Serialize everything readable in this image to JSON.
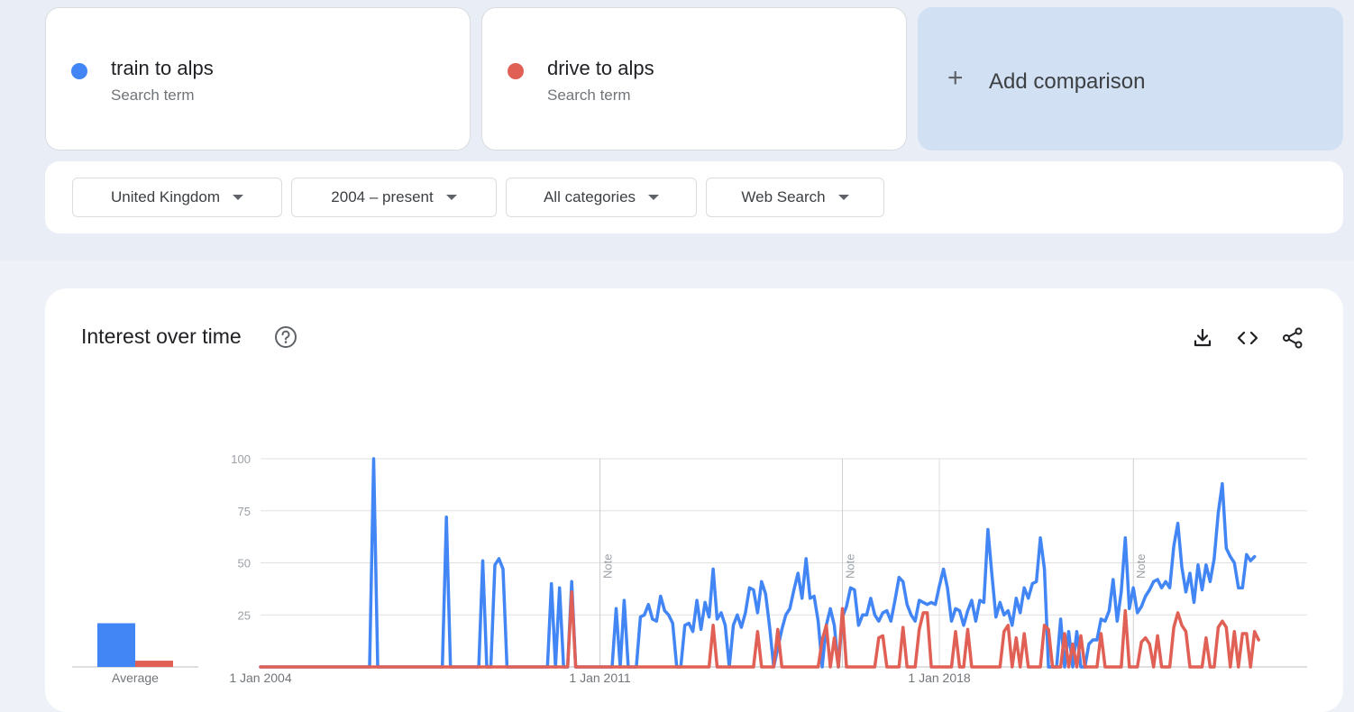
{
  "terms": [
    {
      "name": "train to alps",
      "type": "Search term",
      "color": "#4285f4"
    },
    {
      "name": "drive to alps",
      "type": "Search term",
      "color": "#e06055"
    }
  ],
  "add_comparison": {
    "icon": "+",
    "label": "Add comparison"
  },
  "filters": [
    {
      "label": "United Kingdom"
    },
    {
      "label": "2004 – present"
    },
    {
      "label": "All categories"
    },
    {
      "label": "Web Search"
    }
  ],
  "panel": {
    "title": "Interest over time",
    "icons": [
      "help-circle-icon",
      "download-icon",
      "embed-code-icon",
      "share-icon"
    ]
  },
  "average": {
    "label": "Average",
    "values": [
      21,
      3
    ]
  },
  "note_label": "Note",
  "chart_data": {
    "type": "line",
    "title": "",
    "xlabel": "",
    "ylabel": "",
    "ylim": [
      0,
      100
    ],
    "yticks": [
      25,
      50,
      75,
      100
    ],
    "xticks": [
      {
        "label": "1 Jan 2004",
        "date": "2004-01"
      },
      {
        "label": "1 Jan 2011",
        "date": "2011-01"
      },
      {
        "label": "1 Jan 2018",
        "date": "2018-01"
      }
    ],
    "x_range": [
      "2004-01",
      "2025-08"
    ],
    "notes": [
      "2011-01",
      "2016-01",
      "2022-01"
    ],
    "grid": true,
    "series": [
      {
        "name": "train to alps",
        "color": "#4285f4",
        "points": [
          [
            "2004-01",
            0
          ],
          [
            "2006-04",
            0
          ],
          [
            "2006-05",
            100
          ],
          [
            "2006-06",
            0
          ],
          [
            "2007-10",
            0
          ],
          [
            "2007-11",
            72
          ],
          [
            "2007-12",
            0
          ],
          [
            "2008-07",
            0
          ],
          [
            "2008-08",
            51
          ],
          [
            "2008-09",
            0
          ],
          [
            "2008-10",
            0
          ],
          [
            "2008-11",
            49
          ],
          [
            "2008-12",
            52
          ],
          [
            "2009-01",
            47
          ],
          [
            "2009-02",
            0
          ],
          [
            "2009-12",
            0
          ],
          [
            "2010-01",
            40
          ],
          [
            "2010-02",
            0
          ],
          [
            "2010-03",
            38
          ],
          [
            "2010-04",
            0
          ],
          [
            "2010-05",
            0
          ],
          [
            "2010-06",
            41
          ],
          [
            "2010-07",
            0
          ],
          [
            "2011-04",
            0
          ],
          [
            "2011-05",
            28
          ],
          [
            "2011-06",
            0
          ],
          [
            "2011-07",
            32
          ],
          [
            "2011-08",
            0
          ],
          [
            "2011-10",
            0
          ],
          [
            "2011-11",
            24
          ],
          [
            "2011-12",
            25
          ],
          [
            "2012-01",
            30
          ],
          [
            "2012-02",
            23
          ],
          [
            "2012-03",
            22
          ],
          [
            "2012-04",
            34
          ],
          [
            "2012-05",
            27
          ],
          [
            "2012-06",
            25
          ],
          [
            "2012-07",
            21
          ],
          [
            "2012-08",
            0
          ],
          [
            "2012-09",
            0
          ],
          [
            "2012-10",
            20
          ],
          [
            "2012-11",
            21
          ],
          [
            "2012-12",
            17
          ],
          [
            "2013-01",
            32
          ],
          [
            "2013-02",
            18
          ],
          [
            "2013-03",
            31
          ],
          [
            "2013-04",
            24
          ],
          [
            "2013-05",
            47
          ],
          [
            "2013-06",
            23
          ],
          [
            "2013-07",
            26
          ],
          [
            "2013-08",
            20
          ],
          [
            "2013-09",
            0
          ],
          [
            "2013-10",
            20
          ],
          [
            "2013-11",
            25
          ],
          [
            "2013-12",
            19
          ],
          [
            "2014-01",
            26
          ],
          [
            "2014-02",
            38
          ],
          [
            "2014-03",
            37
          ],
          [
            "2014-04",
            26
          ],
          [
            "2014-05",
            41
          ],
          [
            "2014-06",
            35
          ],
          [
            "2014-07",
            19
          ],
          [
            "2014-08",
            0
          ],
          [
            "2014-10",
            18
          ],
          [
            "2014-11",
            25
          ],
          [
            "2014-12",
            28
          ],
          [
            "2015-01",
            37
          ],
          [
            "2015-02",
            45
          ],
          [
            "2015-03",
            33
          ],
          [
            "2015-04",
            52
          ],
          [
            "2015-05",
            33
          ],
          [
            "2015-06",
            34
          ],
          [
            "2015-07",
            22
          ],
          [
            "2015-08",
            0
          ],
          [
            "2015-09",
            20
          ],
          [
            "2015-10",
            28
          ],
          [
            "2015-11",
            20
          ],
          [
            "2015-12",
            0
          ],
          [
            "2016-01",
            24
          ],
          [
            "2016-02",
            29
          ],
          [
            "2016-03",
            38
          ],
          [
            "2016-04",
            37
          ],
          [
            "2016-05",
            20
          ],
          [
            "2016-06",
            25
          ],
          [
            "2016-07",
            25
          ],
          [
            "2016-08",
            33
          ],
          [
            "2016-09",
            25
          ],
          [
            "2016-10",
            22
          ],
          [
            "2016-11",
            26
          ],
          [
            "2016-12",
            27
          ],
          [
            "2017-01",
            22
          ],
          [
            "2017-02",
            32
          ],
          [
            "2017-03",
            43
          ],
          [
            "2017-04",
            41
          ],
          [
            "2017-05",
            30
          ],
          [
            "2017-06",
            25
          ],
          [
            "2017-07",
            22
          ],
          [
            "2017-08",
            32
          ],
          [
            "2017-09",
            31
          ],
          [
            "2017-10",
            30
          ],
          [
            "2017-11",
            31
          ],
          [
            "2017-12",
            30
          ],
          [
            "2018-01",
            39
          ],
          [
            "2018-02",
            47
          ],
          [
            "2018-03",
            38
          ],
          [
            "2018-04",
            22
          ],
          [
            "2018-05",
            28
          ],
          [
            "2018-06",
            27
          ],
          [
            "2018-07",
            20
          ],
          [
            "2018-08",
            27
          ],
          [
            "2018-09",
            32
          ],
          [
            "2018-10",
            22
          ],
          [
            "2018-11",
            32
          ],
          [
            "2018-12",
            31
          ],
          [
            "2019-01",
            66
          ],
          [
            "2019-02",
            44
          ],
          [
            "2019-03",
            24
          ],
          [
            "2019-04",
            31
          ],
          [
            "2019-05",
            25
          ],
          [
            "2019-06",
            27
          ],
          [
            "2019-07",
            20
          ],
          [
            "2019-08",
            33
          ],
          [
            "2019-09",
            26
          ],
          [
            "2019-10",
            38
          ],
          [
            "2019-11",
            33
          ],
          [
            "2019-12",
            40
          ],
          [
            "2020-01",
            41
          ],
          [
            "2020-02",
            62
          ],
          [
            "2020-03",
            47
          ],
          [
            "2020-04",
            0
          ],
          [
            "2020-05",
            0
          ],
          [
            "2020-06",
            0
          ],
          [
            "2020-07",
            23
          ],
          [
            "2020-08",
            0
          ],
          [
            "2020-09",
            17
          ],
          [
            "2020-10",
            0
          ],
          [
            "2020-11",
            17
          ],
          [
            "2020-12",
            0
          ],
          [
            "2021-01",
            0
          ],
          [
            "2021-02",
            11
          ],
          [
            "2021-03",
            13
          ],
          [
            "2021-04",
            13
          ],
          [
            "2021-05",
            23
          ],
          [
            "2021-06",
            22
          ],
          [
            "2021-07",
            27
          ],
          [
            "2021-08",
            42
          ],
          [
            "2021-09",
            22
          ],
          [
            "2021-10",
            36
          ],
          [
            "2021-11",
            62
          ],
          [
            "2021-12",
            28
          ],
          [
            "2022-01",
            38
          ],
          [
            "2022-02",
            26
          ],
          [
            "2022-03",
            29
          ],
          [
            "2022-04",
            34
          ],
          [
            "2022-05",
            37
          ],
          [
            "2022-06",
            41
          ],
          [
            "2022-07",
            42
          ],
          [
            "2022-08",
            38
          ],
          [
            "2022-09",
            41
          ],
          [
            "2022-10",
            38
          ],
          [
            "2022-11",
            58
          ],
          [
            "2022-12",
            69
          ],
          [
            "2023-01",
            48
          ],
          [
            "2023-02",
            36
          ],
          [
            "2023-03",
            45
          ],
          [
            "2023-04",
            31
          ],
          [
            "2023-05",
            49
          ],
          [
            "2023-06",
            37
          ],
          [
            "2023-07",
            49
          ],
          [
            "2023-08",
            41
          ],
          [
            "2023-09",
            52
          ],
          [
            "2023-10",
            74
          ],
          [
            "2023-11",
            88
          ],
          [
            "2023-12",
            57
          ],
          [
            "2024-01",
            53
          ],
          [
            "2024-02",
            50
          ],
          [
            "2024-03",
            38
          ],
          [
            "2024-04",
            38
          ],
          [
            "2024-05",
            54
          ],
          [
            "2024-06",
            51
          ],
          [
            "2024-07",
            53
          ]
        ]
      },
      {
        "name": "drive to alps",
        "color": "#e06055",
        "points": [
          [
            "2004-01",
            0
          ],
          [
            "2010-05",
            0
          ],
          [
            "2010-06",
            36
          ],
          [
            "2010-07",
            0
          ],
          [
            "2013-04",
            0
          ],
          [
            "2013-05",
            20
          ],
          [
            "2013-06",
            0
          ],
          [
            "2014-03",
            0
          ],
          [
            "2014-04",
            17
          ],
          [
            "2014-05",
            0
          ],
          [
            "2014-08",
            0
          ],
          [
            "2014-09",
            18
          ],
          [
            "2014-10",
            0
          ],
          [
            "2015-07",
            0
          ],
          [
            "2015-08",
            13
          ],
          [
            "2015-09",
            20
          ],
          [
            "2015-10",
            0
          ],
          [
            "2015-11",
            14
          ],
          [
            "2015-12",
            0
          ],
          [
            "2016-01",
            28
          ],
          [
            "2016-02",
            0
          ],
          [
            "2016-09",
            0
          ],
          [
            "2016-10",
            14
          ],
          [
            "2016-11",
            15
          ],
          [
            "2016-12",
            0
          ],
          [
            "2017-03",
            0
          ],
          [
            "2017-04",
            19
          ],
          [
            "2017-05",
            0
          ],
          [
            "2017-07",
            0
          ],
          [
            "2017-08",
            18
          ],
          [
            "2017-09",
            26
          ],
          [
            "2017-10",
            26
          ],
          [
            "2017-11",
            0
          ],
          [
            "2018-04",
            0
          ],
          [
            "2018-05",
            17
          ],
          [
            "2018-06",
            0
          ],
          [
            "2018-07",
            0
          ],
          [
            "2018-08",
            18
          ],
          [
            "2018-09",
            0
          ],
          [
            "2019-04",
            0
          ],
          [
            "2019-05",
            17
          ],
          [
            "2019-06",
            20
          ],
          [
            "2019-07",
            0
          ],
          [
            "2019-08",
            14
          ],
          [
            "2019-09",
            0
          ],
          [
            "2019-10",
            16
          ],
          [
            "2019-11",
            0
          ],
          [
            "2020-02",
            0
          ],
          [
            "2020-03",
            20
          ],
          [
            "2020-04",
            18
          ],
          [
            "2020-05",
            0
          ],
          [
            "2020-07",
            0
          ],
          [
            "2020-08",
            16
          ],
          [
            "2020-09",
            0
          ],
          [
            "2020-10",
            11
          ],
          [
            "2020-11",
            0
          ],
          [
            "2020-12",
            15
          ],
          [
            "2021-01",
            0
          ],
          [
            "2021-04",
            0
          ],
          [
            "2021-05",
            16
          ],
          [
            "2021-06",
            0
          ],
          [
            "2021-10",
            0
          ],
          [
            "2021-11",
            27
          ],
          [
            "2021-12",
            0
          ],
          [
            "2022-02",
            0
          ],
          [
            "2022-03",
            12
          ],
          [
            "2022-04",
            14
          ],
          [
            "2022-05",
            11
          ],
          [
            "2022-06",
            0
          ],
          [
            "2022-07",
            15
          ],
          [
            "2022-08",
            0
          ],
          [
            "2022-10",
            0
          ],
          [
            "2022-11",
            19
          ],
          [
            "2022-12",
            26
          ],
          [
            "2023-01",
            20
          ],
          [
            "2023-02",
            17
          ],
          [
            "2023-03",
            0
          ],
          [
            "2023-06",
            0
          ],
          [
            "2023-07",
            14
          ],
          [
            "2023-08",
            0
          ],
          [
            "2023-09",
            0
          ],
          [
            "2023-10",
            19
          ],
          [
            "2023-11",
            22
          ],
          [
            "2023-12",
            19
          ],
          [
            "2024-01",
            0
          ],
          [
            "2024-02",
            17
          ],
          [
            "2024-03",
            0
          ],
          [
            "2024-04",
            16
          ],
          [
            "2024-05",
            16
          ],
          [
            "2024-06",
            0
          ],
          [
            "2024-07",
            17
          ],
          [
            "2024-08",
            13
          ]
        ]
      }
    ]
  }
}
